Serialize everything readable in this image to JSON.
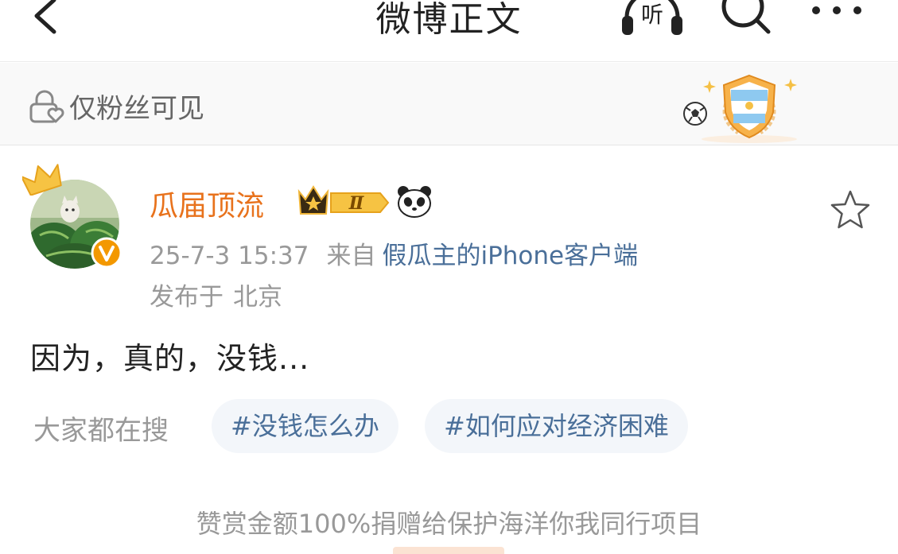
{
  "nav": {
    "title": "微博正文",
    "listen_label": "听"
  },
  "visibility": {
    "text": "仅粉丝可见"
  },
  "post": {
    "username": "瓜届顶流",
    "vip_level": "Ⅱ",
    "time": "25-7-3 15:37",
    "from_label": "来自",
    "source": "假瓜主的iPhone客户端",
    "location_label": "发布于",
    "location": "北京",
    "text": "因为，真的，没钱..."
  },
  "search": {
    "label": "大家都在搜",
    "tags": [
      "#没钱怎么办",
      "#如何应对经济困难"
    ]
  },
  "reward": {
    "text": "赞赏金额100%捐赠给保护海洋你我同行项目"
  },
  "colors": {
    "username": "#e8721c",
    "link": "#4a6f99",
    "muted": "#999999",
    "verified": "#f39800"
  }
}
